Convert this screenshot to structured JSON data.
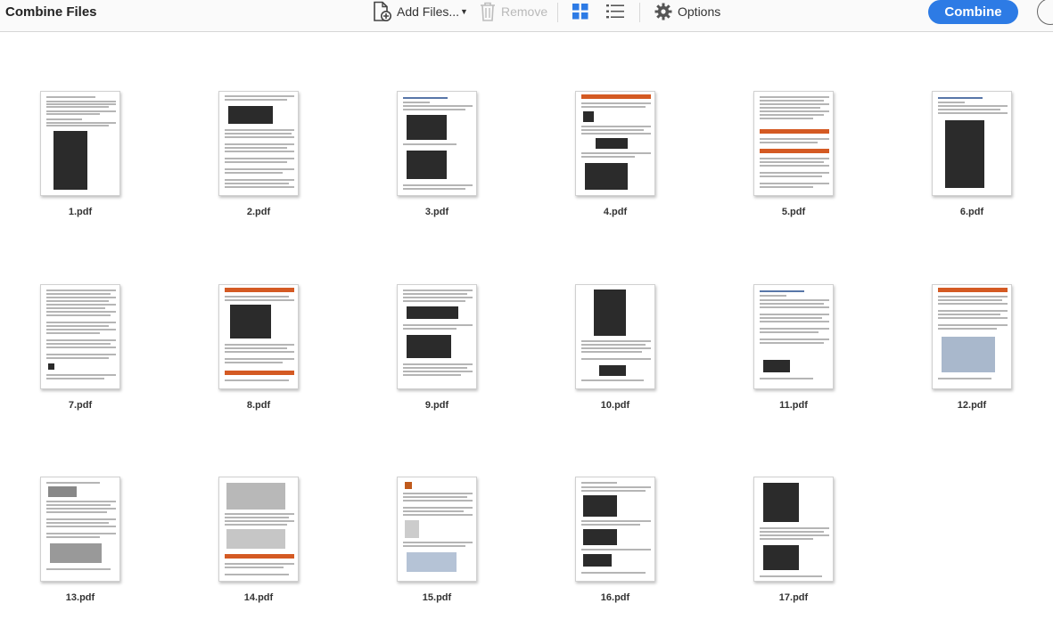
{
  "app": {
    "title": "Combine Files"
  },
  "toolbar": {
    "add_files_label": "Add Files...",
    "remove_label": "Remove",
    "options_label": "Options",
    "combine_label": "Combine",
    "view_mode": "grid"
  },
  "colors": {
    "accent": "#2d7be5",
    "disabled": "#b9b9b9",
    "grid_icon": "#2d7be5"
  },
  "files": [
    {
      "name": "1.pdf"
    },
    {
      "name": "2.pdf"
    },
    {
      "name": "3.pdf"
    },
    {
      "name": "4.pdf"
    },
    {
      "name": "5.pdf"
    },
    {
      "name": "6.pdf"
    },
    {
      "name": "7.pdf"
    },
    {
      "name": "8.pdf"
    },
    {
      "name": "9.pdf"
    },
    {
      "name": "10.pdf"
    },
    {
      "name": "11.pdf"
    },
    {
      "name": "12.pdf"
    },
    {
      "name": "13.pdf"
    },
    {
      "name": "14.pdf"
    },
    {
      "name": "15.pdf"
    },
    {
      "name": "16.pdf"
    },
    {
      "name": "17.pdf"
    }
  ]
}
